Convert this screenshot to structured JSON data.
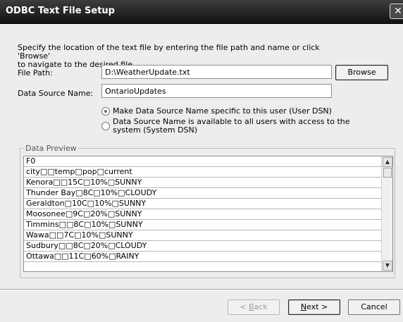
{
  "window": {
    "title": "ODBC Text File Setup",
    "close_glyph": "✕"
  },
  "intro": {
    "line1": "Specify the location of the text file by entering the file path and name or click 'Browse'",
    "line2": "to navigate to the desired file."
  },
  "file_path": {
    "label": "File Path:",
    "value": "D:\\WeatherUpdate.txt",
    "browse_label": "Browse"
  },
  "dsn": {
    "label": "Data Source Name:",
    "value": "OntarioUpdates"
  },
  "dsn_scope": {
    "options": [
      {
        "line1": "Make Data Source Name specific to this user (User DSN)",
        "line2": "",
        "selected": true
      },
      {
        "line1": "Data Source Name is available to all users with access to the",
        "line2": "system (System DSN)",
        "selected": false
      }
    ]
  },
  "preview": {
    "legend": "Data Preview",
    "header": "F0",
    "rows": [
      "city□□temp□pop□current",
      "Kenora□□15C□10%□SUNNY",
      "Thunder Bay□8C□10%□CLOUDY",
      "Geraldton□10C□10%□SUNNY",
      "Moosonee□9C□20%□SUNNY",
      "Timmins□□8C□10%□SUNNY",
      "Wawa□□7C□10%□SUNNY",
      "Sudbury□□8C□20%□CLOUDY",
      "Ottawa□□11C□60%□RAINY"
    ],
    "scroll_up_glyph": "▲",
    "scroll_down_glyph": "▼"
  },
  "footer": {
    "back_prefix": "< ",
    "back_key": "B",
    "back_rest": "ack",
    "next_key": "N",
    "next_rest": "ext >",
    "cancel_label": "Cancel"
  },
  "icons": {
    "close": "close-icon",
    "scroll_up": "scroll-up-icon",
    "scroll_down": "scroll-down-icon"
  }
}
